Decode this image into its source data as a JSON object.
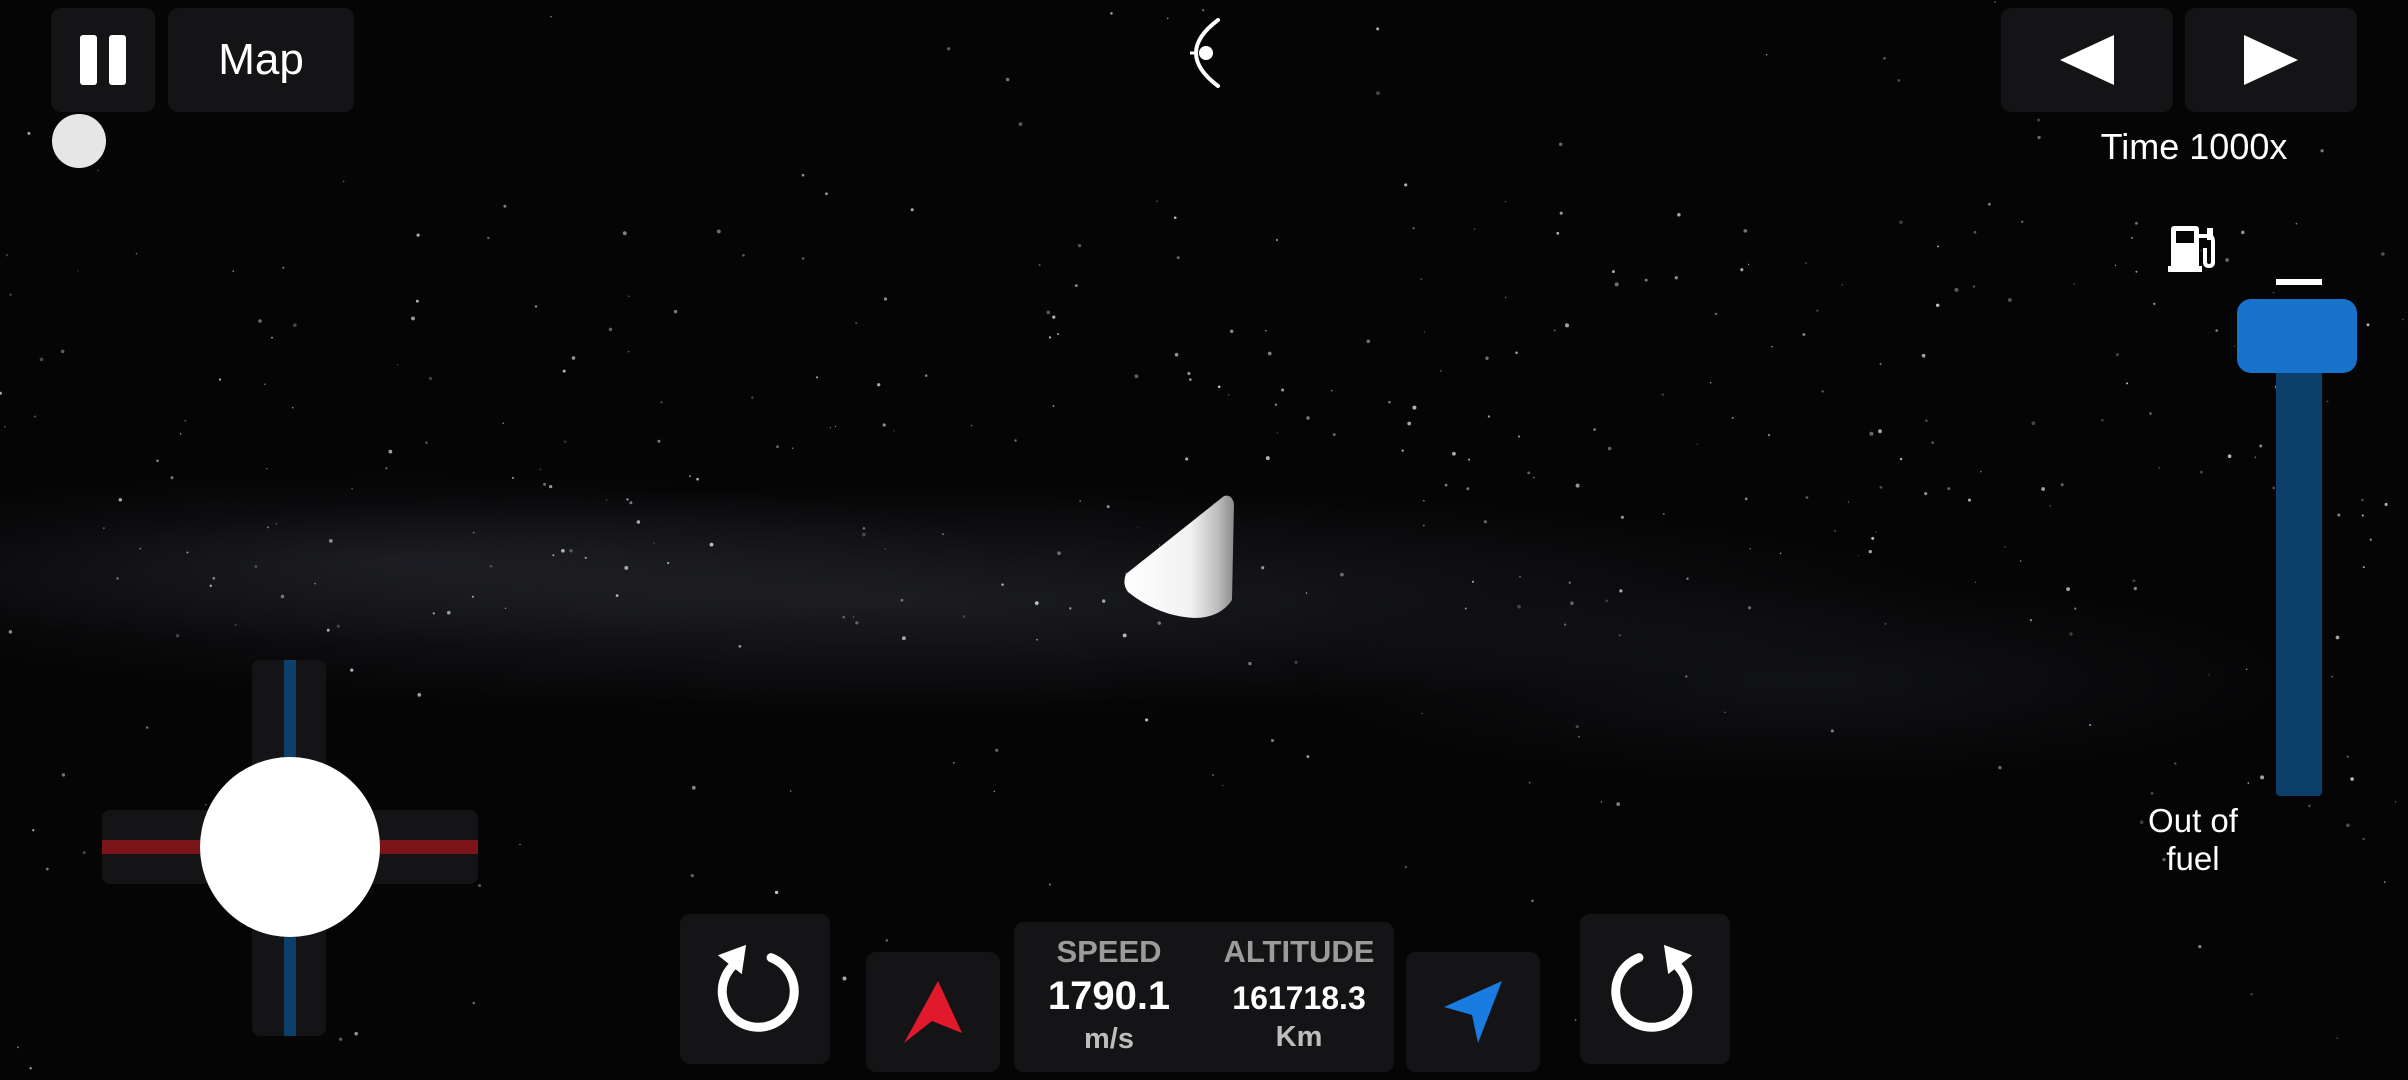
{
  "top_left": {
    "pause_icon": "pause-icon",
    "map_label": "Map"
  },
  "top_center": {
    "orbit_icon": "orbit-view-icon"
  },
  "top_right": {
    "prev_icon": "triangle-left-icon",
    "next_icon": "triangle-right-icon",
    "time_label": "Time 1000x"
  },
  "throttle": {
    "fuel_icon": "fuel-pump-icon",
    "level": 1.0,
    "fuel_status": "Out of fuel"
  },
  "telemetry": {
    "speed_label": "SPEED",
    "speed_value": "1790.1",
    "speed_unit": "m/s",
    "altitude_label": "ALTITUDE",
    "altitude_value": "161718.3",
    "altitude_unit": "Km"
  },
  "controls": {
    "rotate_left_icon": "rotate-left-icon",
    "retrograde_icon": "retrograde-arrow-icon",
    "prograde_icon": "prograde-arrow-icon",
    "rotate_right_icon": "rotate-right-icon"
  },
  "colors": {
    "accent_blue": "#1673c9",
    "track_blue": "#0d3f6b",
    "retro_red": "#e0192c",
    "prograde_blue": "#1a7be0",
    "joystick_red": "#7a1418"
  }
}
